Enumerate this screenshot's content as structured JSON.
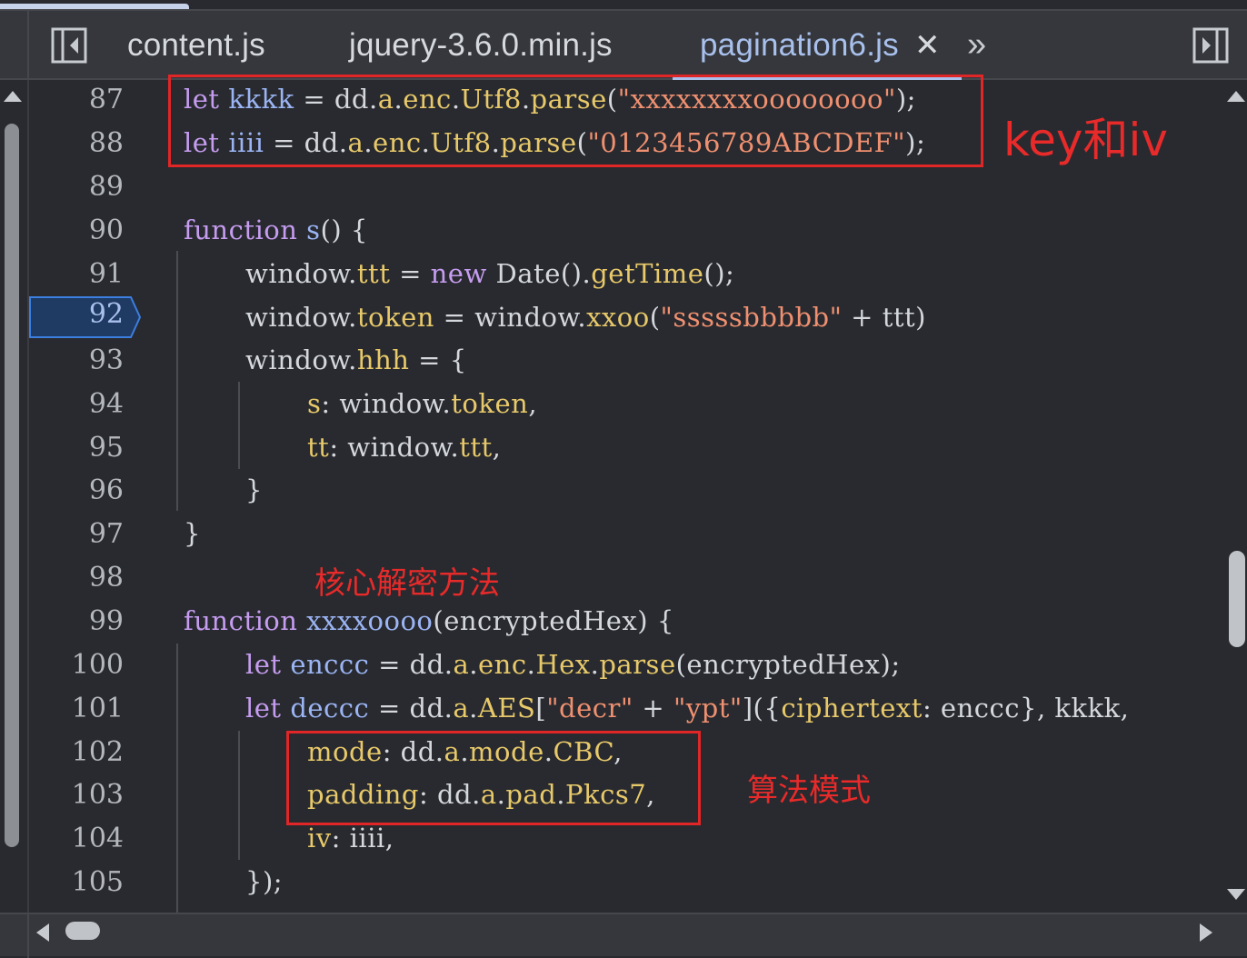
{
  "tabs": [
    {
      "label": "content.js",
      "active": false
    },
    {
      "label": "jquery-3.6.0.min.js",
      "active": false
    },
    {
      "label": "pagination6.js",
      "active": true
    }
  ],
  "tab_close_glyph": "✕",
  "more_tabs_glyph": "»",
  "icons": {
    "left_panel": "panel-left-icon",
    "right_panel": "panel-right-icon",
    "close": "close-icon",
    "more": "chevron-double-right-icon"
  },
  "active_line": "92",
  "lines": [
    {
      "num": "87"
    },
    {
      "num": "88"
    },
    {
      "num": "89"
    },
    {
      "num": "90"
    },
    {
      "num": "91"
    },
    {
      "num": "92"
    },
    {
      "num": "93"
    },
    {
      "num": "94"
    },
    {
      "num": "95"
    },
    {
      "num": "96"
    },
    {
      "num": "97"
    },
    {
      "num": "98"
    },
    {
      "num": "99"
    },
    {
      "num": "100"
    },
    {
      "num": "101"
    },
    {
      "num": "102"
    },
    {
      "num": "103"
    },
    {
      "num": "104"
    },
    {
      "num": "105"
    }
  ],
  "code": {
    "l87": [
      "let",
      " ",
      "kkkk",
      " = dd.",
      "a",
      ".",
      "enc",
      ".",
      "Utf8",
      ".",
      "parse",
      "(",
      "\"xxxxxxxxoooooooo\"",
      ");"
    ],
    "l88": [
      "let",
      " ",
      "iiii",
      " = dd.",
      "a",
      ".",
      "enc",
      ".",
      "Utf8",
      ".",
      "parse",
      "(",
      "\"0123456789ABCDEF\"",
      ");"
    ],
    "l90": [
      "function",
      " ",
      "s",
      "() {"
    ],
    "l91": [
      "window.",
      "ttt",
      " = ",
      "new",
      " Date().",
      "getTime",
      "();"
    ],
    "l92": [
      "window.",
      "token",
      " = window.",
      "xxoo",
      "(",
      "\"sssssbbbbb\"",
      " + ttt)"
    ],
    "l93": [
      "window.",
      "hhh",
      " = {"
    ],
    "l94": [
      "s",
      ": window.",
      "token",
      ","
    ],
    "l95": [
      "tt",
      ": window.",
      "ttt",
      ","
    ],
    "l96": [
      "}"
    ],
    "l97": [
      "}"
    ],
    "l99": [
      "function",
      " ",
      "xxxxoooo",
      "(encryptedHex) {"
    ],
    "l100": [
      "let",
      " ",
      "enccc",
      " = dd.",
      "a",
      ".",
      "enc",
      ".",
      "Hex",
      ".",
      "parse",
      "(encryptedHex);"
    ],
    "l101": [
      "let",
      " ",
      "deccc",
      " = dd.",
      "a",
      ".",
      "AES",
      "[",
      "\"decr\"",
      " + ",
      "\"ypt\"",
      "]({",
      "ciphertext",
      ": enccc}, kkkk,"
    ],
    "l102": [
      "mode",
      ": dd.",
      "a",
      ".",
      "mode",
      ".",
      "CBC",
      ","
    ],
    "l103": [
      "padding",
      ": dd.",
      "a",
      ".",
      "pad",
      ".",
      "Pkcs7",
      ","
    ],
    "l104": [
      "iv",
      ": iiii,"
    ],
    "l105": [
      "});"
    ]
  },
  "annotations": {
    "key_iv": "key和iv",
    "core_decrypt": "核心解密方法",
    "algo_mode": "算法模式"
  },
  "colors": {
    "keyword": "#c69cf0",
    "variable": "#9bb4f4",
    "property": "#e8c96a",
    "string": "#f09070",
    "annotation_red": "#e02626",
    "active_tab": "#a8c0ec"
  }
}
